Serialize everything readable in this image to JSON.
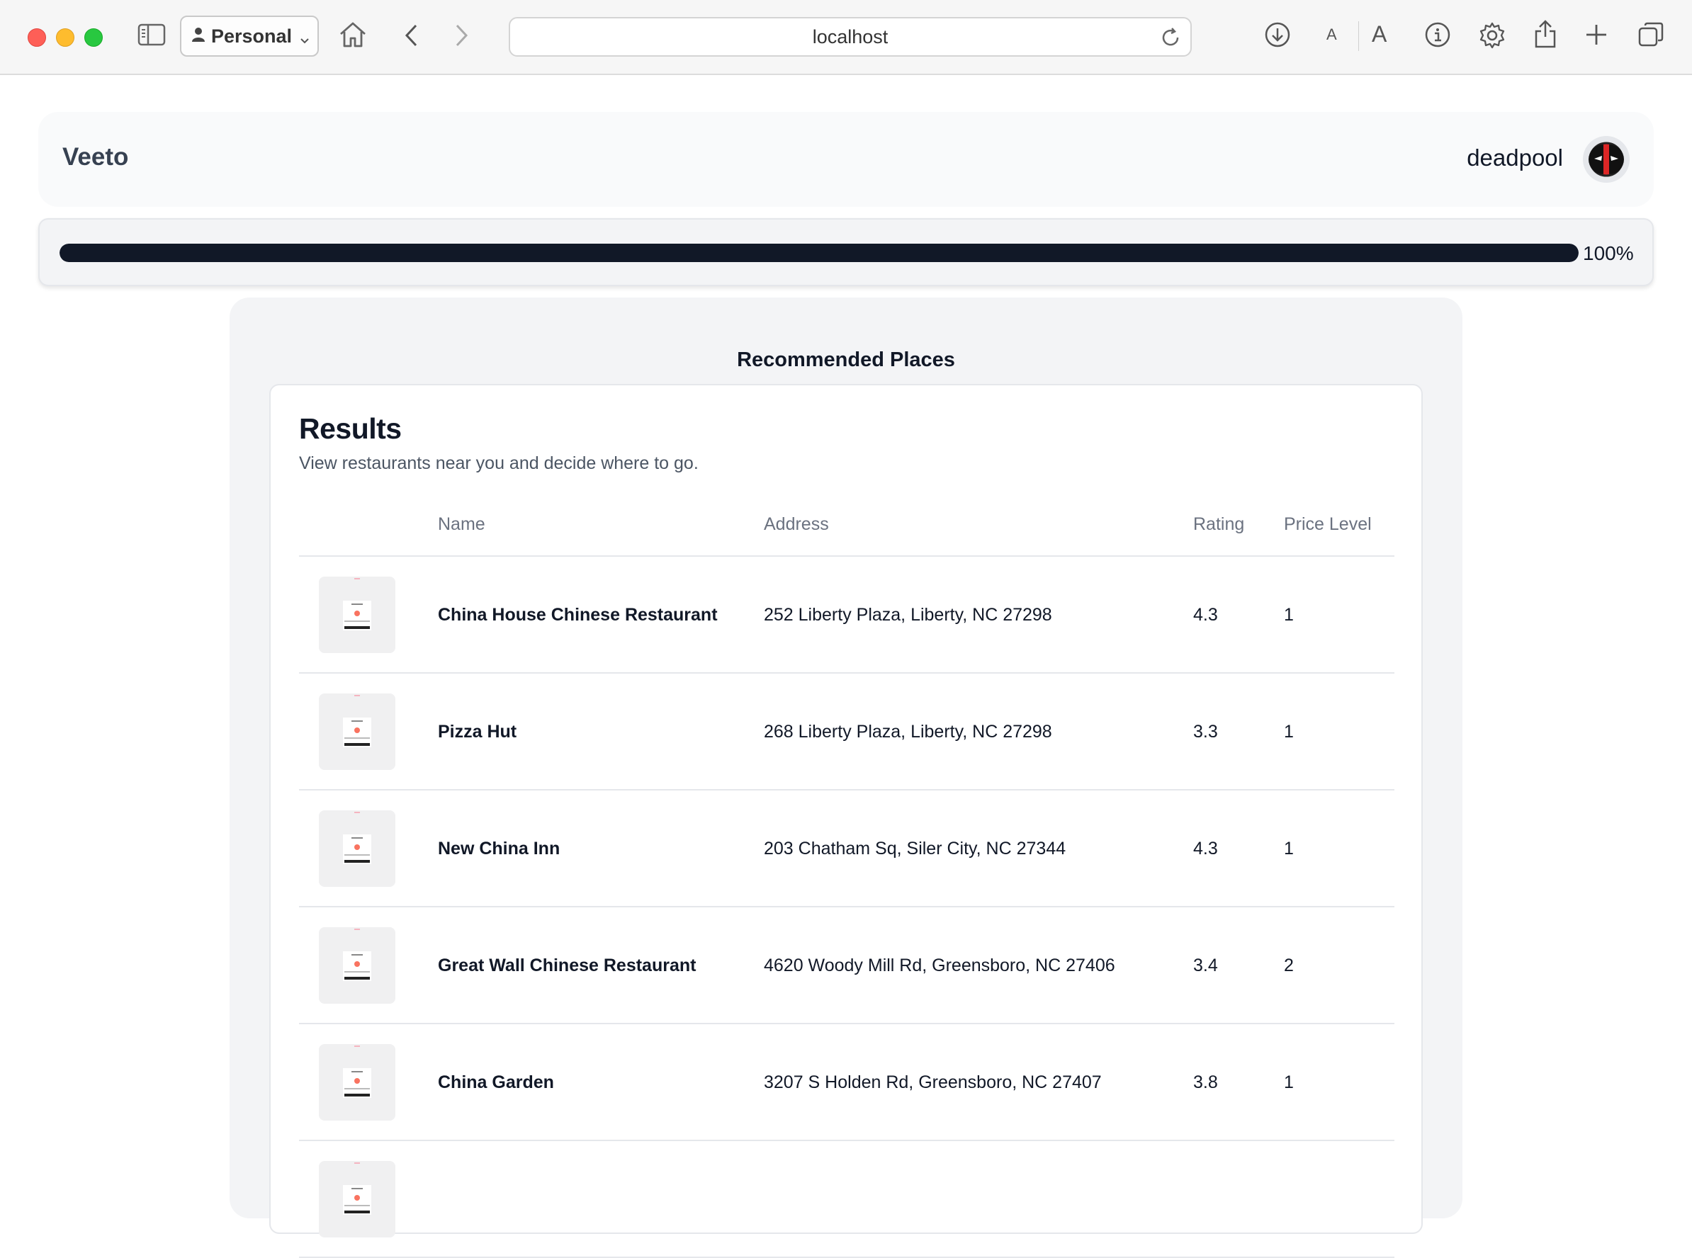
{
  "browser": {
    "profile": "Personal",
    "url": "localhost"
  },
  "header": {
    "brand": "Veeto",
    "username": "deadpool"
  },
  "progress": {
    "value_percent": 100,
    "label": "100%"
  },
  "panel": {
    "title": "Recommended Places"
  },
  "results": {
    "heading": "Results",
    "subtitle": "View restaurants near you and decide where to go.",
    "columns": {
      "name": "Name",
      "address": "Address",
      "rating": "Rating",
      "price": "Price Level"
    },
    "rows": [
      {
        "name": "China House Chinese Restaurant",
        "address": "252 Liberty Plaza, Liberty, NC 27298",
        "rating": "4.3",
        "price": "1"
      },
      {
        "name": "Pizza Hut",
        "address": "268 Liberty Plaza, Liberty, NC 27298",
        "rating": "3.3",
        "price": "1"
      },
      {
        "name": "New China Inn",
        "address": "203 Chatham Sq, Siler City, NC 27344",
        "rating": "4.3",
        "price": "1"
      },
      {
        "name": "Great Wall Chinese Restaurant",
        "address": "4620 Woody Mill Rd, Greensboro, NC 27406",
        "rating": "3.4",
        "price": "2"
      },
      {
        "name": "China Garden",
        "address": "3207 S Holden Rd, Greensboro, NC 27407",
        "rating": "3.8",
        "price": "1"
      },
      {
        "name": "",
        "address": "",
        "rating": "",
        "price": ""
      }
    ]
  },
  "colors": {
    "progress_fill": "#111827",
    "avatar_red": "#dc2626"
  }
}
